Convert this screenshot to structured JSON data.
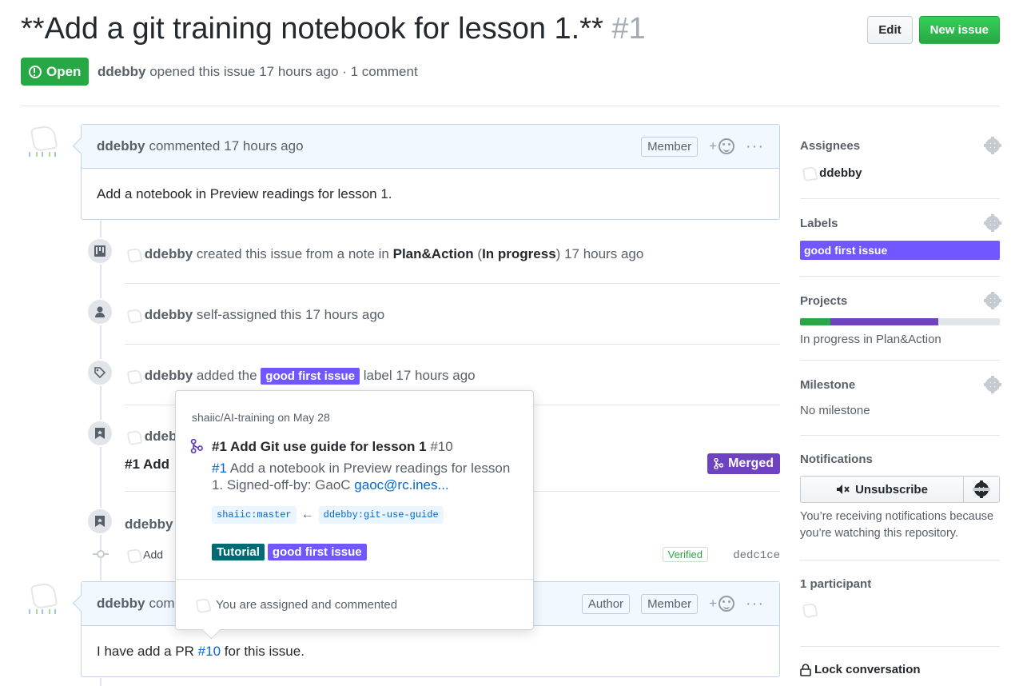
{
  "issue": {
    "title": "**Add a git training notebook for lesson 1.**",
    "number": "#1",
    "state": "Open",
    "author": "ddebby",
    "meta_text": "opened this issue 17 hours ago · 1 comment"
  },
  "header_buttons": {
    "edit": "Edit",
    "new_issue": "New issue"
  },
  "comment1": {
    "author": "ddebby",
    "action": "commented",
    "time": "17 hours ago",
    "role": "Member",
    "react_plus": "+",
    "more": "···",
    "body": "Add a notebook in Preview readings for lesson 1."
  },
  "events": {
    "created": {
      "user": "ddebby",
      "text1": "created this issue from a note in",
      "project": "Plan&Action",
      "column": "In progress",
      "time": "17 hours ago"
    },
    "assigned": {
      "user": "ddebby",
      "text": "self-assigned this 17 hours ago"
    },
    "labeled": {
      "user": "ddebby",
      "text1": "added the",
      "label": "good first issue",
      "text2": "label 17 hours ago"
    },
    "ref": {
      "user": "ddeb",
      "pr_title": "#1 Add",
      "merged": "Merged"
    },
    "commit_ref": {
      "user": "ddebby",
      "commit_msg": "Add",
      "verified": "Verified",
      "sha": "dedc1ce"
    }
  },
  "hovercard": {
    "repo": "shaiic/AI-training",
    "date": "on May 28",
    "pr_title": "#1 Add Git use guide for lesson 1",
    "pr_number": "#10",
    "desc_link": "#1",
    "desc_text": "Add a notebook in Preview readings for lesson 1. Signed-off-by: GaoC",
    "desc_email": "gaoc@rc.ines...",
    "base_branch": "shaiic:master",
    "arrow": "←",
    "head_branch": "ddebby:git-use-guide",
    "labels": [
      "Tutorial",
      "good first issue"
    ],
    "footer": "You are assigned and commented"
  },
  "comment2": {
    "author": "ddebby",
    "action_partial": "com",
    "role1": "Author",
    "role2": "Member",
    "react_plus": "+",
    "more": "···",
    "body_prefix": "I have add a PR",
    "body_link": "#10",
    "body_suffix": "for this issue."
  },
  "sidebar": {
    "assignees": {
      "heading": "Assignees",
      "user": "ddebby"
    },
    "labels": {
      "heading": "Labels",
      "label": "good first issue"
    },
    "projects": {
      "heading": "Projects",
      "status": "In progress in Plan&Action",
      "done_fraction": 0.15,
      "in_progress_fraction": 0.54
    },
    "milestone": {
      "heading": "Milestone",
      "value": "No milestone"
    },
    "notifications": {
      "heading": "Notifications",
      "button": "Unsubscribe",
      "reason": "You’re receiving notifications because you’re watching this repository."
    },
    "participants": {
      "heading": "1 participant"
    },
    "lock": "Lock conversation"
  },
  "colors": {
    "open_green": "#28a745",
    "label_purple": "#7057ff",
    "label_teal": "#006b75",
    "merged_purple": "#6f42c1",
    "link_blue": "#0366d6"
  }
}
